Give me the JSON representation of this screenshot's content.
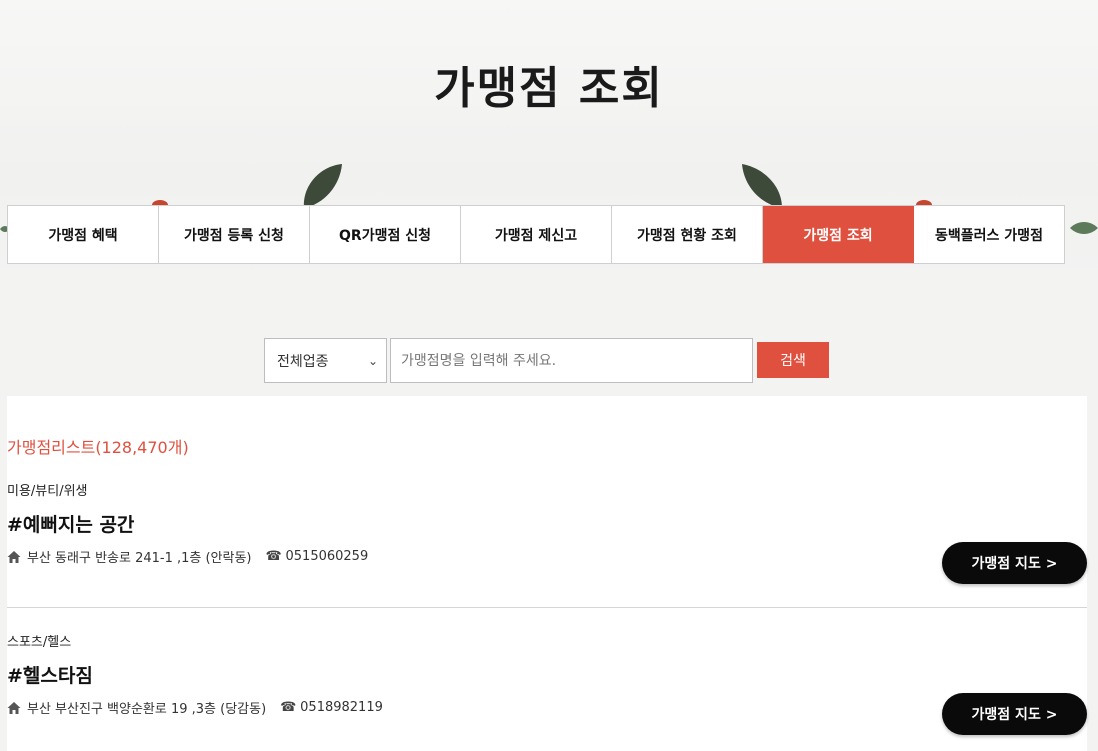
{
  "page": {
    "title": "가맹점 조회"
  },
  "tabs": [
    {
      "label": "가맹점 혜택",
      "active": false
    },
    {
      "label": "가맹점 등록 신청",
      "active": false
    },
    {
      "label": "QR가맹점 신청",
      "active": false
    },
    {
      "label": "가맹점 제신고",
      "active": false
    },
    {
      "label": "가맹점 현황 조회",
      "active": false
    },
    {
      "label": "가맹점 조회",
      "active": true
    },
    {
      "label": "동백플러스 가맹점",
      "active": false
    }
  ],
  "search": {
    "category_selected": "전체업종",
    "placeholder": "가맹점명을 입력해 주세요.",
    "button_label": "검색"
  },
  "list": {
    "count_label": "가맹점리스트(128,470개)",
    "stores": [
      {
        "category": "미용/뷰티/위생",
        "name": "#예뻐지는 공간",
        "address": "부산 동래구 반송로 241-1 ,1층 (안락동)",
        "phone": "0515060259",
        "map_button": "가맹점 지도 >"
      },
      {
        "category": "스포츠/헬스",
        "name": "#헬스타짐",
        "address": "부산 부산진구 백양순환로 19 ,3층 (당감동)",
        "phone": "0518982119",
        "map_button": "가맹점 지도 >"
      }
    ]
  },
  "colors": {
    "accent": "#e0503f",
    "map_button": "#0a0a0a"
  },
  "icons": {
    "address": "home-icon",
    "phone": "phone-icon",
    "select": "chevron-down-icon"
  }
}
